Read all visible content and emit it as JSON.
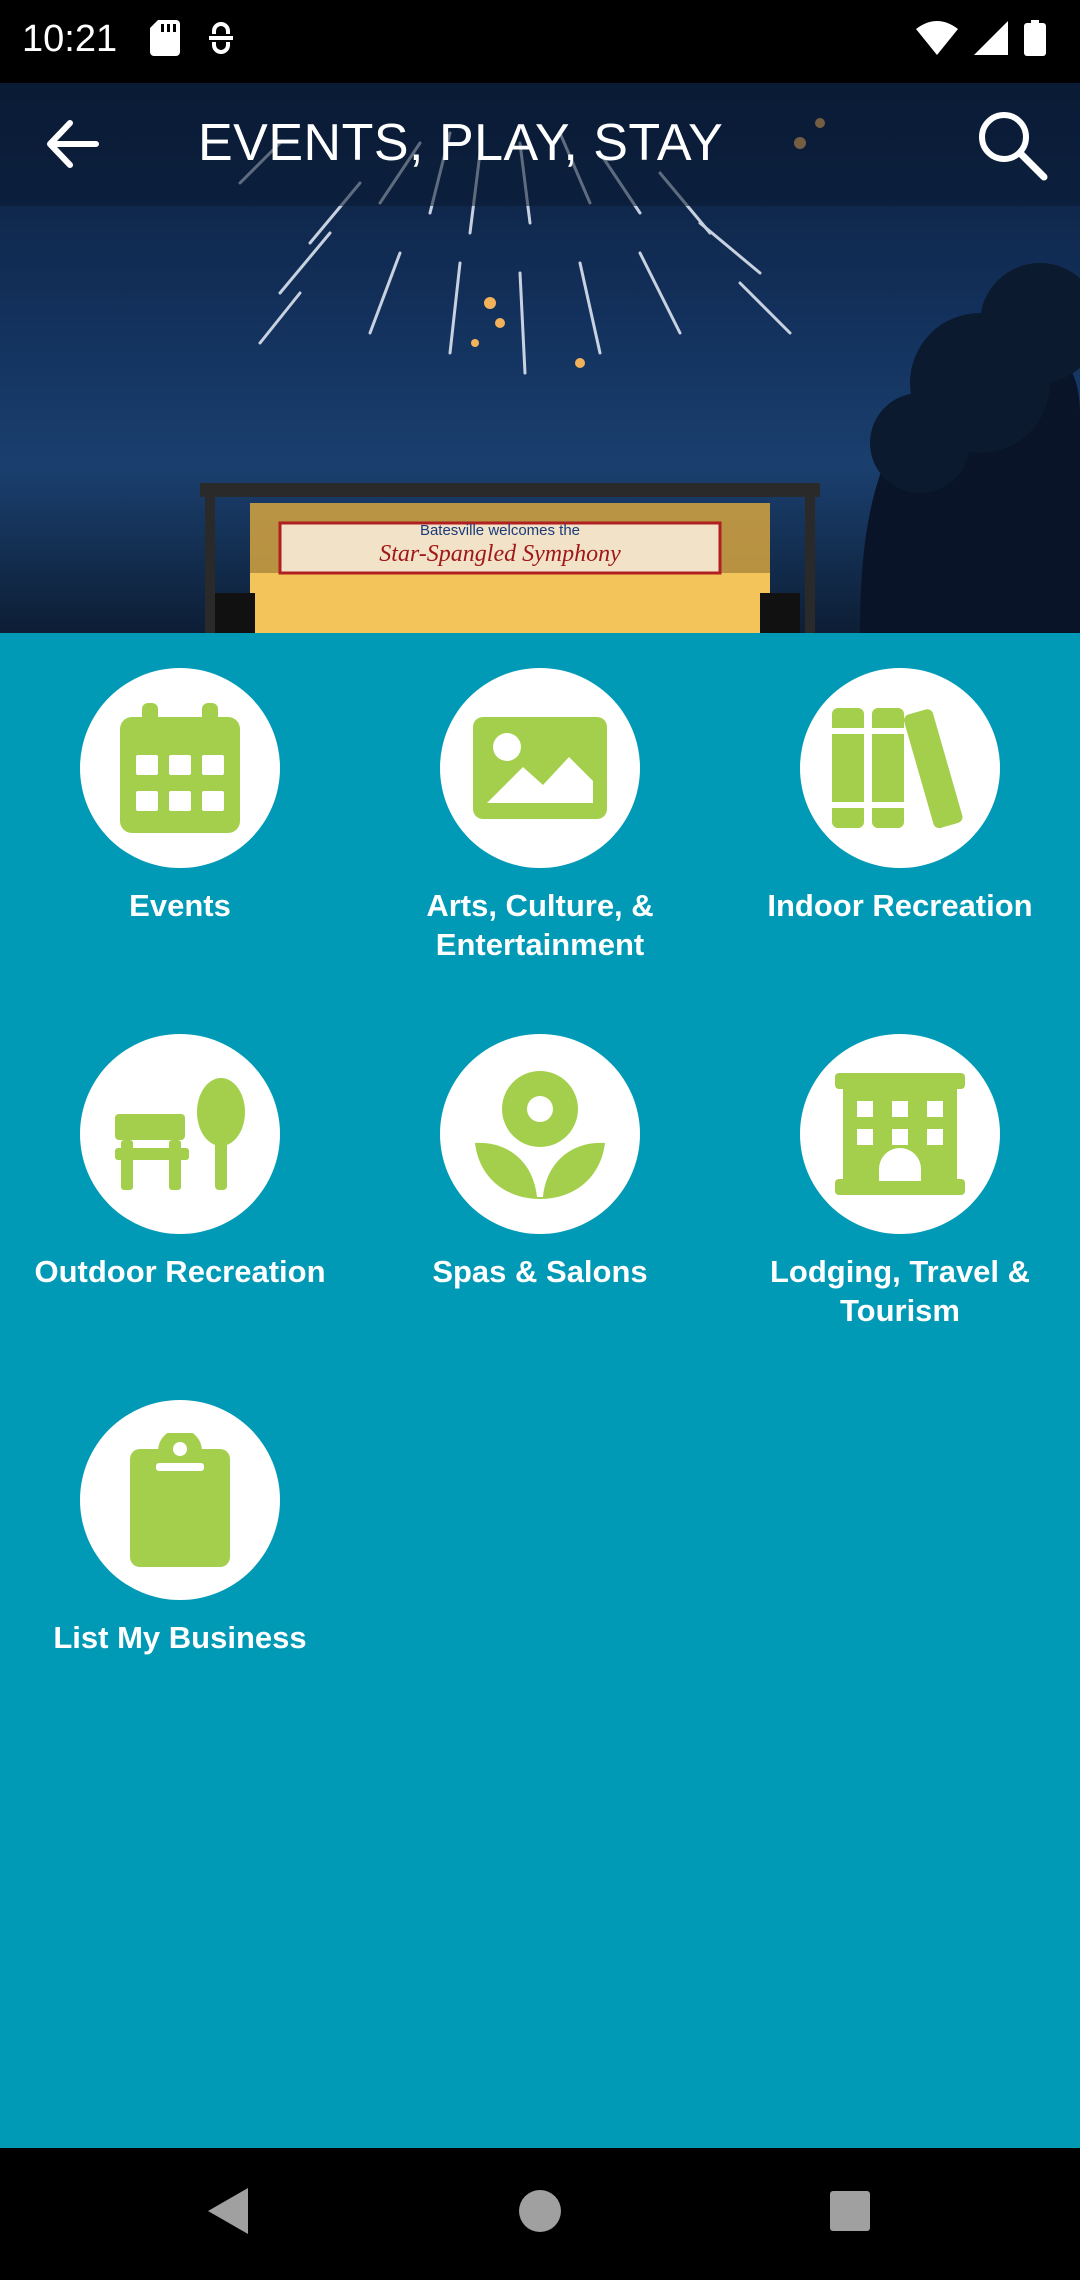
{
  "status_bar": {
    "time": "10:21",
    "left_icons": [
      "sd-card-icon",
      "vpn-key-icon"
    ],
    "right_icons": [
      "wifi-icon",
      "signal-icon",
      "battery-icon"
    ]
  },
  "hero": {
    "banner_line1": "Batesville welcomes the",
    "banner_line2": "Star-Spangled Symphony"
  },
  "app_bar": {
    "title": "EVENTS, PLAY, STAY",
    "back_icon": "arrow-left-icon",
    "search_icon": "search-icon"
  },
  "categories": [
    {
      "label": "Events",
      "icon": "calendar-icon"
    },
    {
      "label": "Arts, Culture, & Entertainment",
      "icon": "image-icon"
    },
    {
      "label": "Indoor Recreation",
      "icon": "books-icon"
    },
    {
      "label": "Outdoor Recreation",
      "icon": "bench-tree-icon"
    },
    {
      "label": "Spas & Salons",
      "icon": "flower-icon"
    },
    {
      "label": "Lodging, Travel & Tourism",
      "icon": "hotel-icon"
    },
    {
      "label": "List My Business",
      "icon": "clipboard-icon"
    }
  ],
  "colors": {
    "background": "#0099b6",
    "icon_green": "#a4cf4c",
    "circle": "#ffffff",
    "text": "#ffffff"
  },
  "nav_bar": {
    "buttons": [
      "back-triangle-icon",
      "home-circle-icon",
      "recents-square-icon"
    ]
  }
}
